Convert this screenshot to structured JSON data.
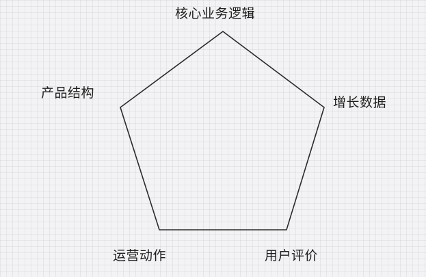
{
  "diagram": {
    "type": "pentagon",
    "nodes": [
      {
        "id": "top",
        "label": "核心业务逻辑"
      },
      {
        "id": "right",
        "label": "增长数据"
      },
      {
        "id": "bottom_right",
        "label": "用户评价"
      },
      {
        "id": "bottom_left",
        "label": "运营动作"
      },
      {
        "id": "left",
        "label": "产品结构"
      }
    ],
    "stroke_color": "#2a2a2a",
    "background_color": "#f3f3f5"
  }
}
